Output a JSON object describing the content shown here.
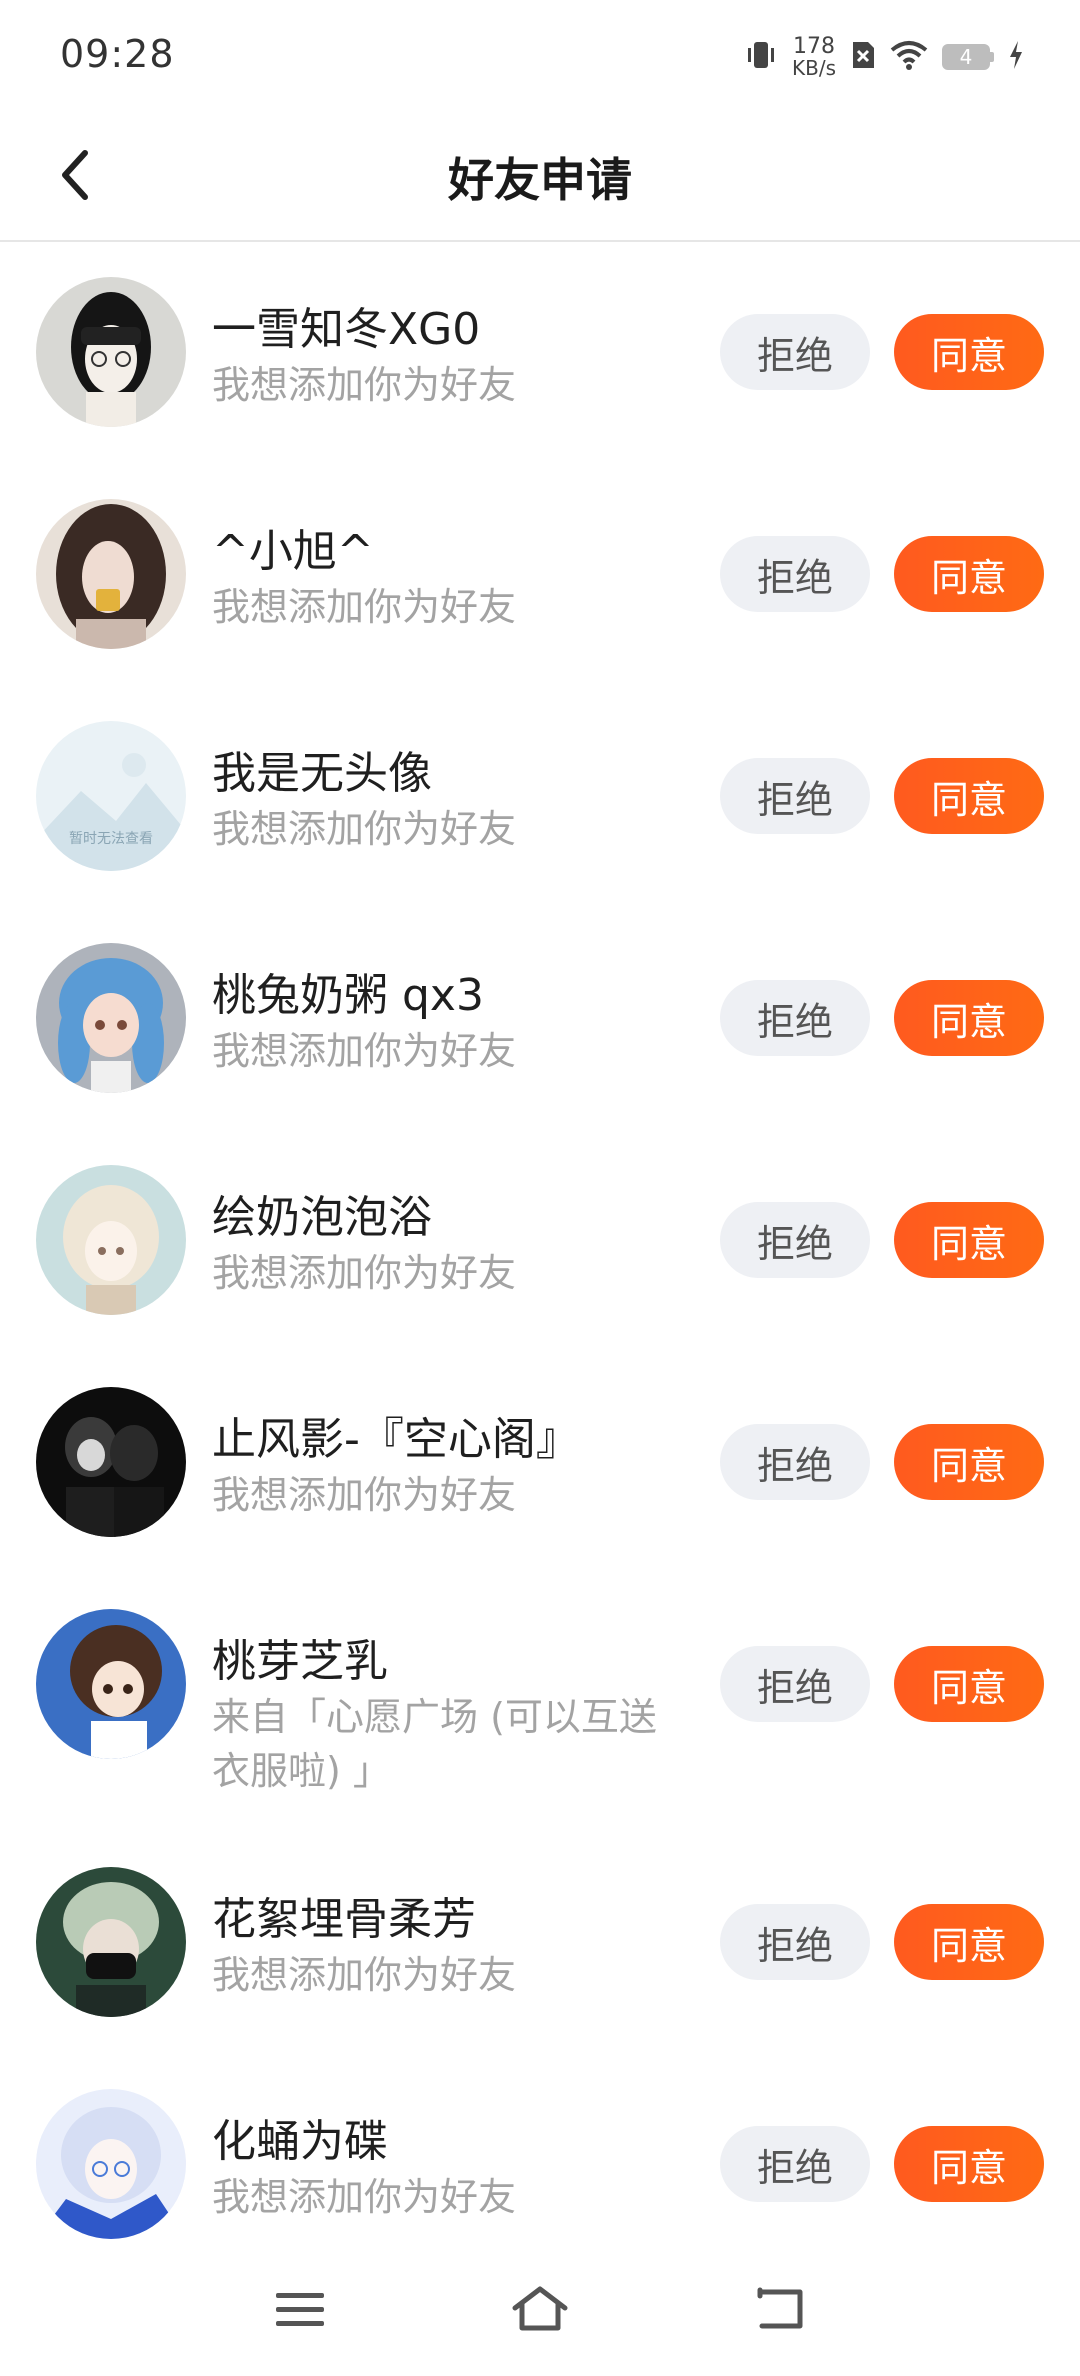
{
  "status_bar": {
    "time": "09:28",
    "net_speed_value": "178",
    "net_speed_unit": "KB/s",
    "battery_level": "4",
    "icons": [
      "vibrate-icon",
      "no-sim-icon",
      "wifi-icon",
      "battery-icon",
      "charging-icon"
    ]
  },
  "header": {
    "title": "好友申请",
    "back_icon": "chevron-left-icon"
  },
  "buttons": {
    "reject_label": "拒绝",
    "accept_label": "同意"
  },
  "requests": [
    {
      "name": "一雪知冬XG0",
      "message": "我想添加你为好友"
    },
    {
      "name": "^小旭^",
      "message": "我想添加你为好友"
    },
    {
      "name": "我是无头像",
      "message": "我想添加你为好友",
      "avatar_text": "暂时无法查看"
    },
    {
      "name": "桃兔奶粥 qx3",
      "message": "我想添加你为好友"
    },
    {
      "name": "绘奶泡泡浴",
      "message": "我想添加你为好友"
    },
    {
      "name": "止风影-『空心阁』",
      "message": "我想添加你为好友"
    },
    {
      "name": "桃芽芝乳",
      "message": "来自「心愿广场 (可以互送衣服啦) 」"
    },
    {
      "name": "花絮埋骨柔芳",
      "message": "我想添加你为好友"
    },
    {
      "name": "化蛹为碟",
      "message": "我想添加你为好友"
    }
  ],
  "nav_bar": {
    "icons": [
      "menu-icon",
      "home-icon",
      "back-icon"
    ]
  },
  "colors": {
    "accent": "#ff5a1f",
    "reject_bg": "#eef0f4",
    "secondary_text": "#a3a3a3"
  }
}
